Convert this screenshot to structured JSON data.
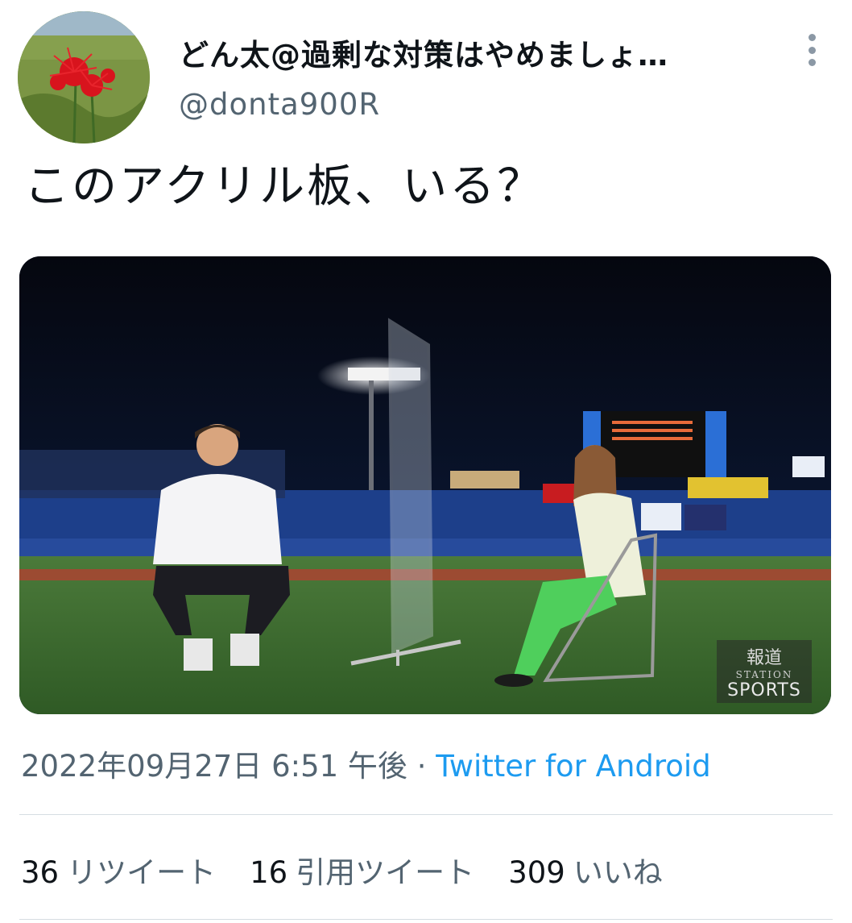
{
  "author": {
    "display_name": "どん太@過剰な対策はやめましょ…",
    "handle": "@donta900R",
    "avatar_icon": "red-spider-lily-avatar"
  },
  "tweet": {
    "text": "このアクリル板、いる？",
    "media": {
      "watermark_line1": "報道",
      "watermark_line2": "STATION",
      "watermark_line3": "SPORTS"
    }
  },
  "meta": {
    "timestamp": "2022年09月27日 6:51 午後",
    "separator": "·",
    "source": "Twitter for Android"
  },
  "stats": {
    "retweets_count": "36",
    "retweets_label": "リツイート",
    "quotes_count": "16",
    "quotes_label": "引用ツイート",
    "likes_count": "309",
    "likes_label": "いいね"
  },
  "colors": {
    "link": "#1d9bf0",
    "secondary_text": "#536471",
    "primary_text": "#0f1419"
  }
}
